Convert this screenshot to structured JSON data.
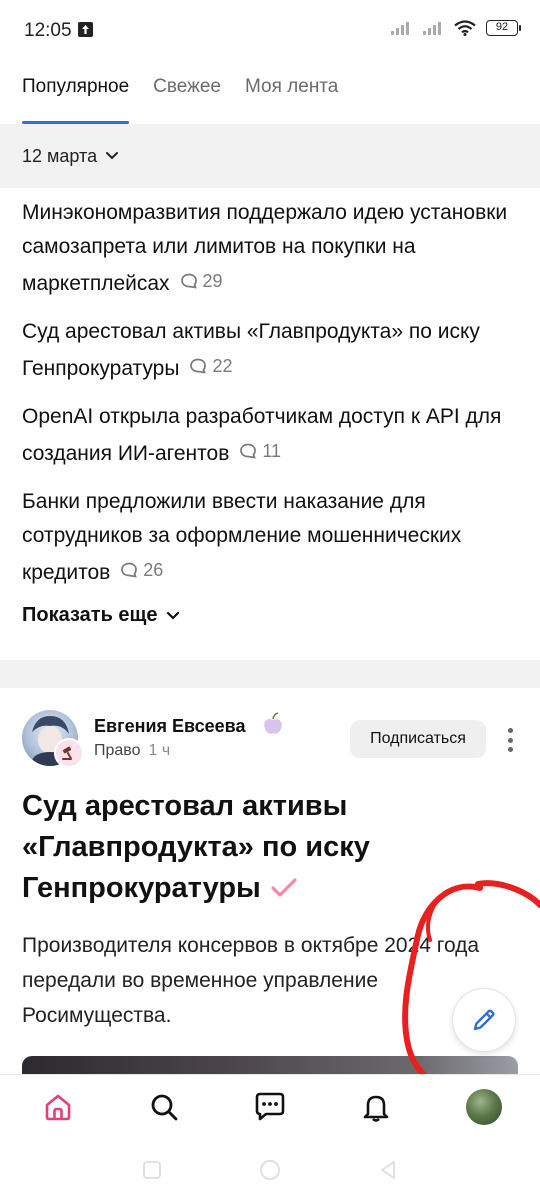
{
  "status_bar": {
    "time": "12:05",
    "battery": "92"
  },
  "tabs": [
    {
      "label": "Популярное",
      "active": true
    },
    {
      "label": "Свежее",
      "active": false
    },
    {
      "label": "Моя лента",
      "active": false
    }
  ],
  "date_filter": {
    "label": "12 марта"
  },
  "news": [
    {
      "title": "Минэкономразвития поддержало идею установки самозапрета или лимитов на покупки на маркетплейсах",
      "comments": "29"
    },
    {
      "title": "Суд арестовал активы «Главпродукта» по иску Генпрокуратуры",
      "comments": "22"
    },
    {
      "title": "OpenAI открыла разработчикам доступ к API для создания ИИ-агентов",
      "comments": "11"
    },
    {
      "title": "Банки предложили ввести наказание для сотрудников за оформление мошеннических кредитов",
      "comments": "26"
    }
  ],
  "show_more_label": "Показать еще",
  "post": {
    "author": "Евгения Евсеева",
    "category": "Право",
    "time": "1 ч",
    "subscribe_label": "Подписаться",
    "title": "Суд арестовал активы «Главпродукта» по иску Генпрокуратуры",
    "description": "Производителя консервов в октябре 2024 года передали во временное управление Росимущества."
  },
  "colors": {
    "accent": "#2f6fd6",
    "home_active": "#e0417a",
    "verified_check": "#f08aa8",
    "annotation": "#e82020"
  },
  "icons": {
    "nav": [
      "home-icon",
      "search-icon",
      "chat-icon",
      "bell-icon",
      "profile-avatar"
    ],
    "fab": "pencil-icon"
  }
}
